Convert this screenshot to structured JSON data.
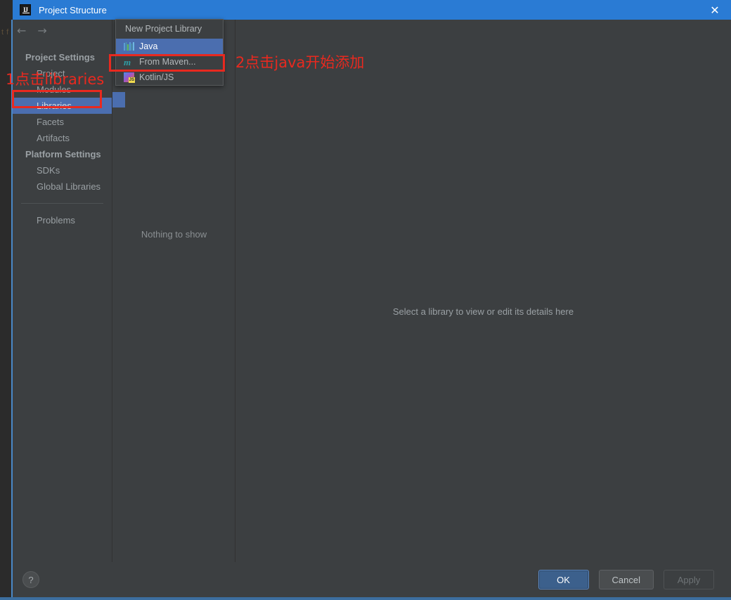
{
  "window": {
    "title": "Project Structure",
    "app_icon": "intellij-idea-icon",
    "close_label": "✕",
    "titlebar_color": "#2a7bd4"
  },
  "nav": {
    "back_label": "←",
    "forward_label": "→",
    "groups": [
      {
        "label": "Project Settings",
        "items": [
          {
            "label": "Project",
            "selected": false
          },
          {
            "label": "Modules",
            "selected": false
          },
          {
            "label": "Libraries",
            "selected": true
          },
          {
            "label": "Facets",
            "selected": false
          },
          {
            "label": "Artifacts",
            "selected": false
          }
        ]
      },
      {
        "label": "Platform Settings",
        "items": [
          {
            "label": "SDKs",
            "selected": false
          },
          {
            "label": "Global Libraries",
            "selected": false
          }
        ]
      }
    ],
    "extra_items": [
      {
        "label": "Problems",
        "selected": false
      }
    ]
  },
  "list_panel": {
    "toolbar": {
      "add_label": "+",
      "remove_label": "−",
      "copy_label": "copy-icon"
    },
    "empty_text": "Nothing to show"
  },
  "popup": {
    "header": "New Project Library",
    "items": [
      {
        "label": "Java",
        "icon": "java-icon",
        "selected": true
      },
      {
        "label": "From Maven...",
        "icon": "maven-icon",
        "selected": false
      },
      {
        "label": "Kotlin/JS",
        "icon": "kotlin-js-icon",
        "selected": false
      }
    ]
  },
  "detail_panel": {
    "hint": "Select a library to view or edit its details here"
  },
  "footer": {
    "help_label": "?",
    "ok_label": "OK",
    "cancel_label": "Cancel",
    "apply_label": "Apply",
    "apply_disabled": true
  },
  "annotations": {
    "color": "#e8291f",
    "step1_text": "1点击libraries",
    "step2_text": "2点击java开始添加"
  },
  "desktop": {
    "ghost_text": "t f"
  }
}
